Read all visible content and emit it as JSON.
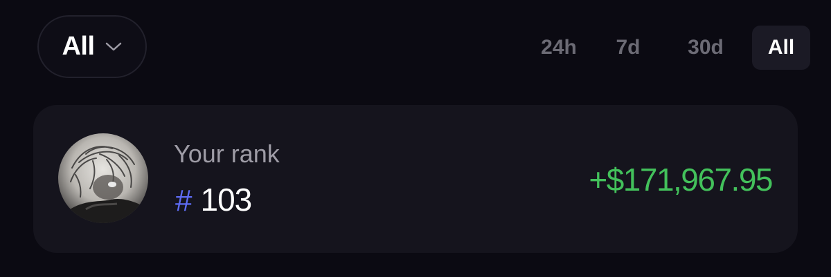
{
  "filter": {
    "selected": "All",
    "icon": "chevron-down-icon"
  },
  "period_tabs": [
    {
      "label": "24h",
      "active": false
    },
    {
      "label": "7d",
      "active": false
    },
    {
      "label": "30d",
      "active": false
    },
    {
      "label": "All",
      "active": true
    }
  ],
  "rank_card": {
    "rank_label": "Your rank",
    "hash_symbol": "#",
    "rank_number": "103",
    "pnl": "+$171,967.95",
    "avatar": "user-avatar"
  },
  "colors": {
    "background": "#0b0a12",
    "card": "#15141d",
    "active_tab": "#1b1a25",
    "inactive_tab_text": "#6c6b75",
    "hash_accent": "#5e6cf5",
    "positive": "#43c15b"
  }
}
